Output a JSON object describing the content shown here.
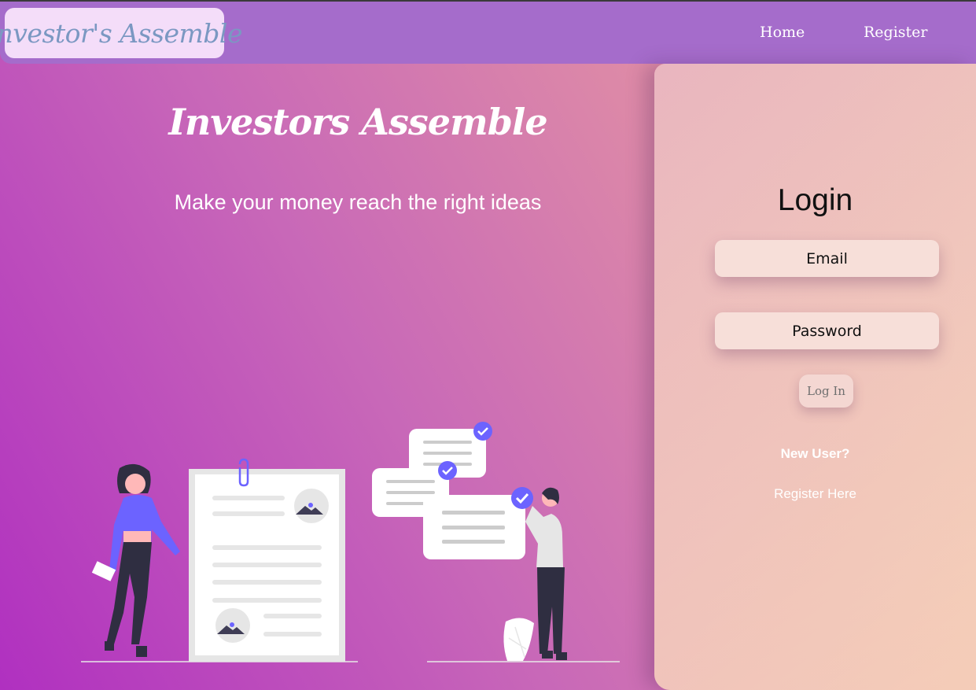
{
  "navbar": {
    "brand": "Investor's Assemble",
    "links": [
      {
        "label": "Home"
      },
      {
        "label": "Register"
      }
    ]
  },
  "hero": {
    "title": "Investors Assemble",
    "subtitle": "Make your money reach the right ideas"
  },
  "login": {
    "title": "Login",
    "email_placeholder": "Email",
    "password_placeholder": "Password",
    "button_label": "Log In",
    "new_user_text": "New User?",
    "register_link": "Register Here"
  },
  "colors": {
    "navbar": "#a56ccb",
    "accent": "#6c63ff",
    "brand_text": "#7b98c2"
  }
}
